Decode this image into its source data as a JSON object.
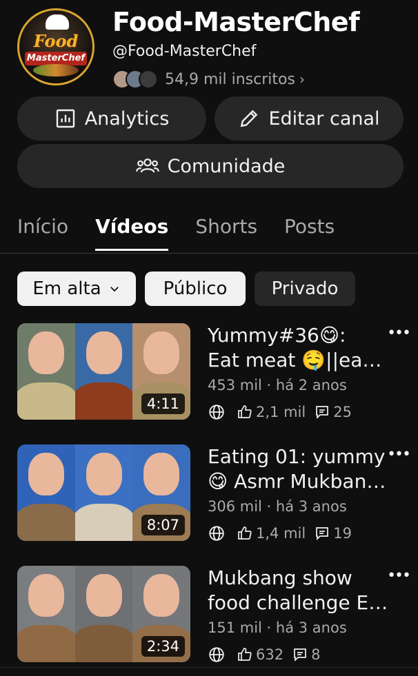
{
  "channel": {
    "name": "Food-MasterChef",
    "handle": "@Food-MasterChef",
    "subscribers": "54,9 mil inscritos",
    "avatar_logo": [
      "Food",
      "MasterChef"
    ]
  },
  "actions": {
    "analytics": "Analytics",
    "edit_channel": "Editar canal",
    "community": "Comunidade"
  },
  "tabs": [
    {
      "label": "Início",
      "active": false
    },
    {
      "label": "Vídeos",
      "active": true
    },
    {
      "label": "Shorts",
      "active": false
    },
    {
      "label": "Posts",
      "active": false
    }
  ],
  "filters": {
    "trending": "Em alta",
    "public": "Público",
    "private": "Privado"
  },
  "videos": [
    {
      "title_line1": "Yummy#36😋:",
      "title_line2": "Eat meat 🤤||eat chicken",
      "meta": "453 mil · há 2 anos",
      "likes": "2,1 mil",
      "comments": "25",
      "duration": "4:11"
    },
    {
      "title_line1": "Eating 01: yummy",
      "title_line2": "😋 Asmr Mukbang show",
      "meta": "306 mil · há 3 anos",
      "likes": "1,4 mil",
      "comments": "19",
      "duration": "8:07"
    },
    {
      "title_line1": "Mukbang show",
      "title_line2": "food challenge Eating",
      "meta": "151 mil · há 3 anos",
      "likes": "632",
      "comments": "8",
      "duration": "2:34"
    }
  ],
  "more_label": "•••"
}
